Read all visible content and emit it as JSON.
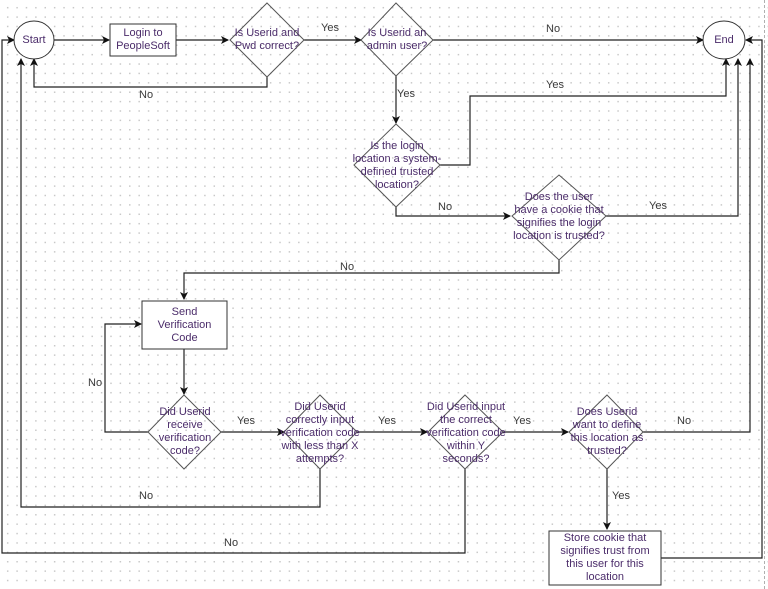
{
  "diagram": {
    "type": "flowchart",
    "nodes": [
      {
        "id": "start",
        "shape": "ellipse",
        "text": "Start"
      },
      {
        "id": "login",
        "shape": "rect",
        "text": "Login to PeopleSoft"
      },
      {
        "id": "pwd",
        "shape": "diamond",
        "text": "Is Userid and Pwd correct?"
      },
      {
        "id": "admin",
        "shape": "diamond",
        "text": "Is Userid an admin user?"
      },
      {
        "id": "end",
        "shape": "ellipse",
        "text": "End"
      },
      {
        "id": "sysloc",
        "shape": "diamond",
        "text": "Is the login location a system-defined trusted location?"
      },
      {
        "id": "cookie",
        "shape": "diamond",
        "text": "Does the user have a cookie that signifies the login location is trusted?"
      },
      {
        "id": "send",
        "shape": "rect",
        "text": "Send Verification Code"
      },
      {
        "id": "receive",
        "shape": "diamond",
        "text": "Did Userid receive verification code?"
      },
      {
        "id": "attempts",
        "shape": "diamond",
        "text": "Did Userid correctly input verification code with less than X attempts?"
      },
      {
        "id": "seconds",
        "shape": "diamond",
        "text": "Did Userid input the correct verification code within Y seconds?"
      },
      {
        "id": "define",
        "shape": "diamond",
        "text": "Does Userid want to define this location as trusted?"
      },
      {
        "id": "store",
        "shape": "rect",
        "text": "Store cookie that signifies trust from this user for this location"
      }
    ],
    "edges": [
      {
        "from": "start",
        "to": "login",
        "label": ""
      },
      {
        "from": "login",
        "to": "pwd",
        "label": ""
      },
      {
        "from": "pwd",
        "to": "admin",
        "label": "Yes"
      },
      {
        "from": "pwd",
        "to": "start",
        "label": "No"
      },
      {
        "from": "admin",
        "to": "end",
        "label": "No"
      },
      {
        "from": "admin",
        "to": "sysloc",
        "label": "Yes"
      },
      {
        "from": "sysloc",
        "to": "end",
        "label": "Yes"
      },
      {
        "from": "sysloc",
        "to": "cookie",
        "label": "No"
      },
      {
        "from": "cookie",
        "to": "end",
        "label": "Yes"
      },
      {
        "from": "cookie",
        "to": "send",
        "label": "No"
      },
      {
        "from": "send",
        "to": "receive",
        "label": ""
      },
      {
        "from": "receive",
        "to": "attempts",
        "label": "Yes"
      },
      {
        "from": "receive",
        "to": "send",
        "label": "No"
      },
      {
        "from": "attempts",
        "to": "seconds",
        "label": "Yes"
      },
      {
        "from": "attempts",
        "to": "start",
        "label": "No"
      },
      {
        "from": "seconds",
        "to": "define",
        "label": "Yes"
      },
      {
        "from": "seconds",
        "to": "start",
        "label": "No"
      },
      {
        "from": "define",
        "to": "end",
        "label": "No"
      },
      {
        "from": "define",
        "to": "store",
        "label": "Yes"
      },
      {
        "from": "store",
        "to": "end",
        "label": ""
      }
    ],
    "labels": {
      "yes": "Yes",
      "no": "No"
    }
  }
}
